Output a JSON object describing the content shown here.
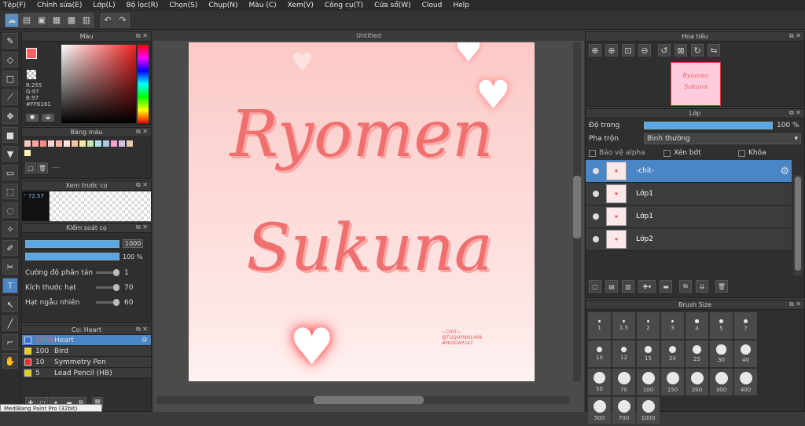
{
  "menu": [
    "Tệp(F)",
    "Chỉnh sửa(E)",
    "Lớp(L)",
    "Bộ lọc(R)",
    "Chọn(S)",
    "Chụp(N)",
    "Màu (C)",
    "Xem(V)",
    "Công cụ(T)",
    "Cửa sổ(W)",
    "Cloud",
    "Help"
  ],
  "canvas": {
    "tab": "Untitled",
    "title_line1": "Ryomen",
    "title_line2": "Sukuna",
    "credit_line1": "~CHIT~",
    "credit_line2": "@TUQUYNH1409",
    "credit_line3": "#HOIDAP247"
  },
  "color_panel": {
    "title": "Màu",
    "r": "R:255",
    "g": "G:97",
    "b": "B:97",
    "hex": "#FF6161",
    "primary": "#ff6161"
  },
  "palette_panel": {
    "title": "Bảng màu",
    "extra": "---",
    "colors": [
      "#f4c7c3",
      "#f6a6a0",
      "#f28b82",
      "#fad2cf",
      "#f9b6b0",
      "#fde2e0",
      "#f7c59f",
      "#fbe8a6",
      "#c6e5b3",
      "#b3e0e6",
      "#a7c7e7",
      "#f7a1c4",
      "#cfc0e8",
      "#e6c9a8",
      "#fff3b0"
    ]
  },
  "preview_panel": {
    "title": "Xem trước cọ",
    "zoom": "72.57"
  },
  "brush_control": {
    "title": "Kiểm soát cọ",
    "size": "1000",
    "opacity": "100 %",
    "rows": [
      {
        "label": "Cường độ phân tán",
        "value": "1"
      },
      {
        "label": "Kích thước hạt",
        "value": "70"
      },
      {
        "label": "Hạt ngẫu nhiên",
        "value": "60"
      }
    ]
  },
  "brush_list": {
    "title": "Cọ: Heart",
    "items": [
      {
        "size": "1000",
        "name": "Heart",
        "color": "#3a6fd8",
        "selected": true
      },
      {
        "size": "100",
        "name": "Bird",
        "color": "#e8d000"
      },
      {
        "size": "10",
        "name": "Symmetry Pen",
        "color": "#e83030"
      },
      {
        "size": "5",
        "name": "Lead Pencil (HB)",
        "color": "#e8d000"
      }
    ]
  },
  "navigator": {
    "title": "Hoa tiêu"
  },
  "layer_panel": {
    "title": "Lớp",
    "opacity_label": "Độ trong",
    "opacity_value": "100 %",
    "blend_label": "Pha trộn",
    "blend_value": "Bình thường",
    "protect_alpha": "Bảo vệ alpha",
    "clip": "Xén bớt",
    "lock": "Khóa",
    "layers": [
      {
        "name": "-chit-",
        "selected": true
      },
      {
        "name": "Lớp1"
      },
      {
        "name": "Lớp1"
      },
      {
        "name": "Lớp2"
      }
    ]
  },
  "brush_size_panel": {
    "title": "Brush Size",
    "sizes": [
      "1",
      "1.5",
      "2",
      "3",
      "4",
      "5",
      "7",
      "10",
      "12",
      "15",
      "20",
      "25",
      "30",
      "40",
      "50",
      "70",
      "100",
      "150",
      "200",
      "300",
      "400",
      "500",
      "700",
      "1000"
    ]
  },
  "status": "MediBang Paint Pro (32bit)"
}
